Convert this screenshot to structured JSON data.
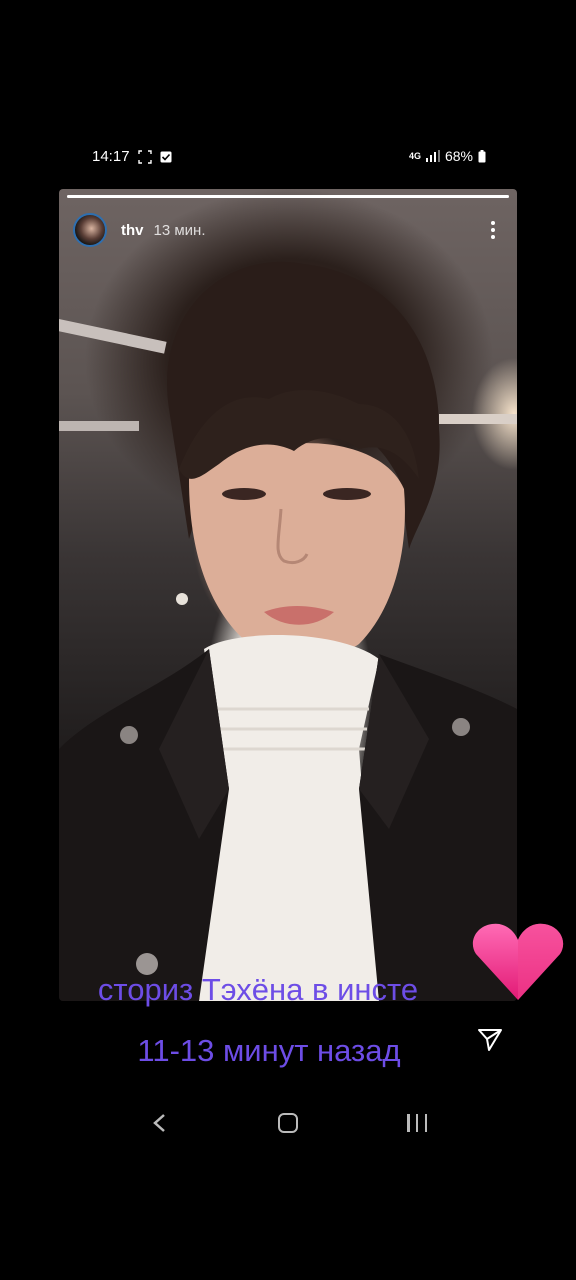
{
  "status_bar": {
    "time": "14:17",
    "network": "4G",
    "battery": "68%"
  },
  "story": {
    "username": "thv",
    "time_ago": "13 мин."
  },
  "overlay": {
    "caption_line1": "сториз Тэхёна в инсте",
    "caption_line2": "11-13 минут назад"
  },
  "colors": {
    "caption": "#6d4de6",
    "heart_top": "#ff6bb5",
    "heart_bottom": "#e21a75"
  },
  "icons": [
    "screenshot-icon",
    "check-notification-icon",
    "network-4g-icon",
    "signal-icon",
    "battery-icon",
    "more-options-icon",
    "send-icon",
    "heart-icon",
    "nav-back-icon",
    "nav-home-icon",
    "nav-recent-icon"
  ]
}
